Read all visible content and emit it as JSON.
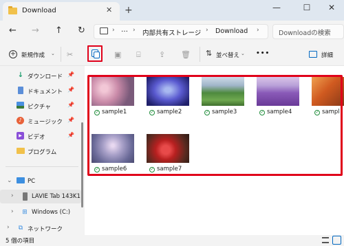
{
  "window": {
    "tab_title": "Download",
    "tab_close": "✕",
    "new_tab": "+",
    "minimize": "—",
    "maximize": "☐",
    "close": "✕"
  },
  "nav": {
    "back": "←",
    "forward": "→",
    "up": "↑",
    "refresh": "↻",
    "breadcrumb": [
      "内部共有ストレージ",
      "Download"
    ],
    "breadcrumb_more": "…",
    "breadcrumb_sep": "›",
    "search_placeholder": "Downloadの検索"
  },
  "toolbar": {
    "new_label": "新規作成",
    "sort_label": "並べ替え",
    "more": "•••",
    "details_label": "詳細"
  },
  "sidebar": {
    "quick_access": [
      {
        "label": "ダウンロード",
        "icon": "download-icon"
      },
      {
        "label": "ドキュメント",
        "icon": "document-icon"
      },
      {
        "label": "ピクチャ",
        "icon": "pictures-icon"
      },
      {
        "label": "ミュージック",
        "icon": "music-icon"
      },
      {
        "label": "ビデオ",
        "icon": "video-icon"
      },
      {
        "label": "プログラム",
        "icon": "folder-icon"
      }
    ],
    "pc": "PC",
    "device": "LAVIE Tab 143K1",
    "drive": "Windows (C:)",
    "network": "ネットワーク"
  },
  "files": [
    {
      "name": "sample1"
    },
    {
      "name": "sample2"
    },
    {
      "name": "sample3"
    },
    {
      "name": "sample4"
    },
    {
      "name": "sampl"
    },
    {
      "name": "sample6"
    },
    {
      "name": "sample7"
    }
  ],
  "status": {
    "item_count": "5 個の項目"
  },
  "colors": {
    "highlight": "#e0001a",
    "accent": "#0067c0",
    "sync_ok": "#1f8c3a"
  }
}
